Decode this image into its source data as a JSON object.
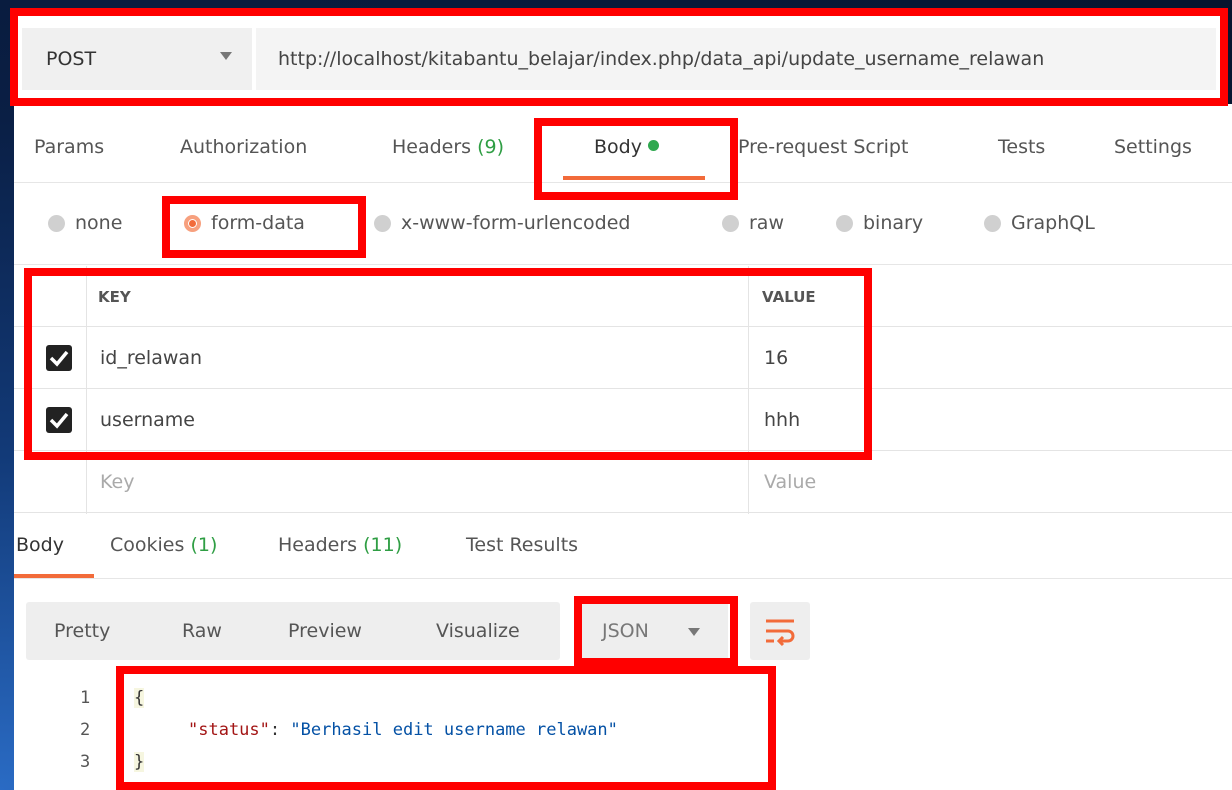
{
  "request": {
    "method": "POST",
    "url": "http://localhost/kitabantu_belajar/index.php/data_api/update_username_relawan"
  },
  "request_tabs": [
    {
      "label": "Params"
    },
    {
      "label": "Authorization"
    },
    {
      "label": "Headers",
      "count": "(9)"
    },
    {
      "label": "Body"
    },
    {
      "label": "Pre-request Script"
    },
    {
      "label": "Tests"
    },
    {
      "label": "Settings"
    }
  ],
  "body_types": [
    "none",
    "form-data",
    "x-www-form-urlencoded",
    "raw",
    "binary",
    "GraphQL"
  ],
  "selected_body_type": "form-data",
  "form_table": {
    "headers": {
      "key": "KEY",
      "value": "VALUE"
    },
    "rows": [
      {
        "key": "id_relawan",
        "value": "16",
        "checked": true
      },
      {
        "key": "username",
        "value": "hhh",
        "checked": true
      }
    ],
    "placeholder": {
      "key": "Key",
      "value": "Value"
    }
  },
  "response_tabs": [
    {
      "label": "Body"
    },
    {
      "label": "Cookies",
      "count": "(1)"
    },
    {
      "label": "Headers",
      "count": "(11)"
    },
    {
      "label": "Test Results"
    }
  ],
  "view_modes": [
    "Pretty",
    "Raw",
    "Preview",
    "Visualize"
  ],
  "format": "JSON",
  "response_body": {
    "line_numbers": [
      "1",
      "2",
      "3"
    ],
    "open_brace": "{",
    "key": "\"status\"",
    "colon": ": ",
    "value": "\"Berhasil edit username relawan\"",
    "close_brace": "}"
  },
  "colors": {
    "accent": "#f26b3a",
    "annotation": "#ff0000",
    "count_green": "#2f9e44",
    "indicator_green": "#2fa84f"
  }
}
